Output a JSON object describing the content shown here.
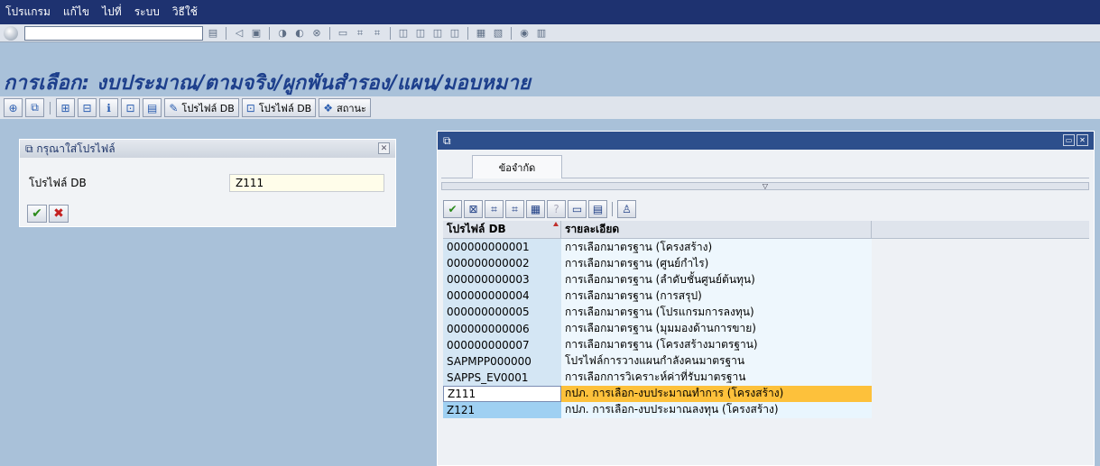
{
  "menu": [
    "โปรแกรม",
    "แก้ไข",
    "ไปที่",
    "ระบบ",
    "วิธีใช้"
  ],
  "page_title": "การเลือก: งบประมาณ/ตามจริง/ผูกพันสำรอง/แผน/มอบหมาย",
  "app_toolbar": {
    "btn1_label": "โปรไฟล์ DB",
    "btn2_label": "โปรไฟล์ DB",
    "btn3_label": "สถานะ"
  },
  "left_dialog": {
    "title": "กรุณาใส่โปรไฟล์",
    "field_label": "โปรไฟล์ DB",
    "field_value": "Z111"
  },
  "right_dialog": {
    "tab_label": "ข้อจำกัด",
    "columns": [
      "โปรไฟล์ DB",
      "รายละเอียด"
    ],
    "rows": [
      {
        "id": "000000000001",
        "desc": "การเลือกมาตรฐาน (โครงสร้าง)"
      },
      {
        "id": "000000000002",
        "desc": "การเลือกมาตรฐาน (ศูนย์กำไร)"
      },
      {
        "id": "000000000003",
        "desc": "การเลือกมาตรฐาน (ลำดับชั้นศูนย์ต้นทุน)"
      },
      {
        "id": "000000000004",
        "desc": "การเลือกมาตรฐาน (การสรุป)"
      },
      {
        "id": "000000000005",
        "desc": "การเลือกมาตรฐาน (โปรแกรมการลงทุน)"
      },
      {
        "id": "000000000006",
        "desc": "การเลือกมาตรฐาน (มุมมองด้านการขาย)"
      },
      {
        "id": "000000000007",
        "desc": "การเลือกมาตรฐาน (โครงสร้างมาตรฐาน)"
      },
      {
        "id": "SAPMPP000000",
        "desc": "โปรไฟล์การวางแผนกำลังคนมาตรฐาน"
      },
      {
        "id": "SAPPS_EV0001",
        "desc": "การเลือกการวิเคราะห์ค่าที่รับมาตรฐาน"
      },
      {
        "id": "Z111",
        "desc": "กปภ. การเลือก-งบประมาณทำการ (โครงสร้าง)"
      },
      {
        "id": "Z121",
        "desc": "กปภ. การเลือก-งบประมาณลงทุน (โครงสร้าง)"
      }
    ]
  },
  "colors": {
    "menubar": "#1e3270",
    "title": "#1d3f8c",
    "selected_row": "#fdc13b",
    "background": "#a9c1d9"
  }
}
